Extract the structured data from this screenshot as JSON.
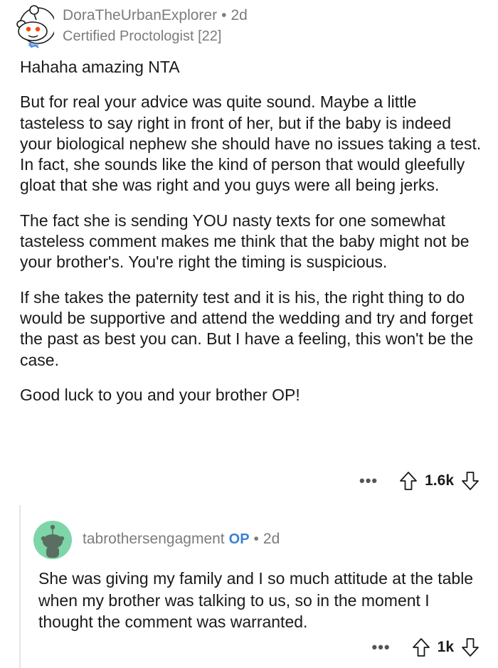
{
  "comment1": {
    "username": "DoraTheUrbanExplorer",
    "separator": "•",
    "age": "2d",
    "flair": "Certified Proctologist [22]",
    "paragraphs": [
      "Hahaha amazing NTA",
      "But for real your advice was quite sound. Maybe a little tasteless to say right in front of her, but if the baby is indeed your biological nephew she should have no issues taking a test. In fact, she sounds like the kind of person that would gleefully gloat that she was right and you guys were all being jerks.",
      "The fact she is sending YOU nasty texts for one somewhat tasteless comment makes me think that the baby might not be your brother's. You're right the timing is suspicious.",
      "If she takes the paternity test and it is his, the right thing to do would be supportive and attend the wedding and try and forget the past as best you can. But I have a feeling, this won't be the case.",
      "Good luck to you and your brother OP!"
    ],
    "more": "•••",
    "score": "1.6k"
  },
  "comment2": {
    "username": "tabrothersengagment",
    "op_badge": "OP",
    "separator": "•",
    "age": "2d",
    "paragraphs": [
      "She was giving my family and I so much attitude at the table when my brother was talking to us, so in the moment I thought the comment was warranted."
    ],
    "more": "•••",
    "score": "1k"
  },
  "colors": {
    "op_badge": "#3a82d6",
    "meta_text": "#7c7c7c",
    "body_text": "#1a1a1b",
    "avatar2_bg": "#7ed6a8"
  }
}
